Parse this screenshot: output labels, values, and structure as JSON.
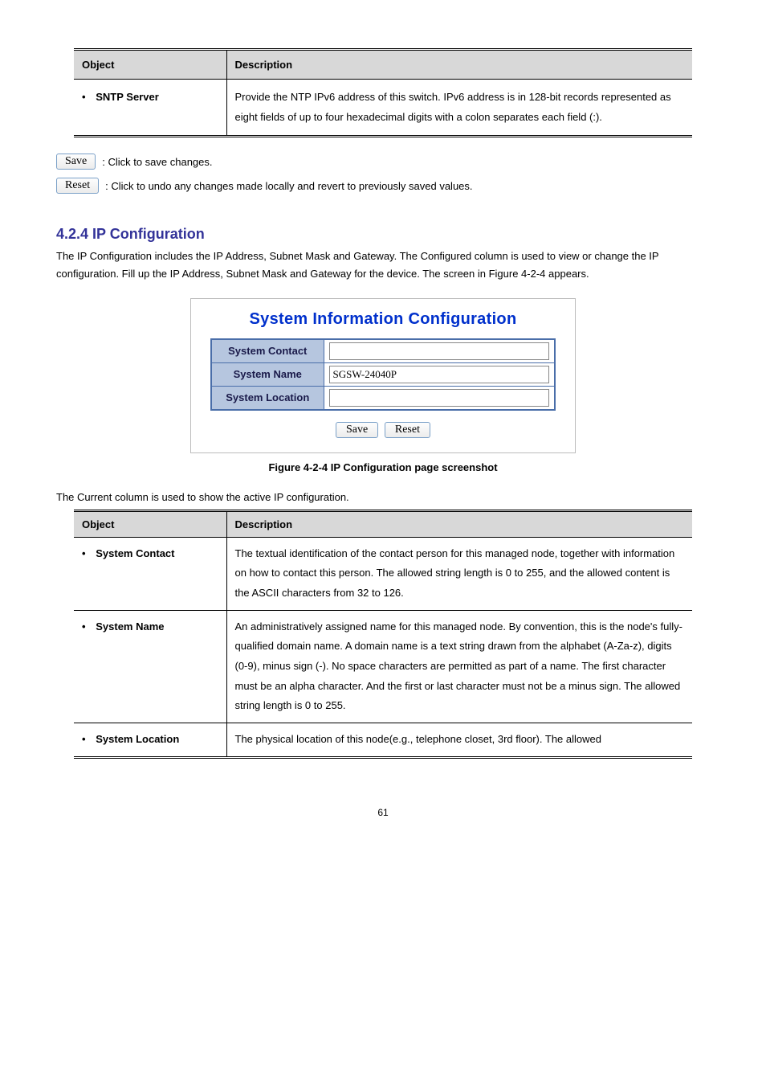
{
  "table1": {
    "headers": {
      "object": "Object",
      "description": "Description"
    },
    "rows": [
      {
        "object": "SNTP Server",
        "description": "Provide the NTP IPv6 address of this switch. IPv6 address is in 128-bit records represented as eight fields of up to four hexadecimal digits with a colon separates each field (:)."
      }
    ]
  },
  "buttons": {
    "save": {
      "label": "Save",
      "desc": ": Click to save changes."
    },
    "reset": {
      "label": "Reset",
      "desc": ": Click to undo any changes made locally and revert to previously saved values."
    }
  },
  "section": {
    "title": "4.2.4 IP Configuration",
    "body": "The IP Configuration includes the IP Address, Subnet Mask and Gateway. The Configured column is used to view or change the IP configuration. Fill up the IP Address, Subnet Mask and Gateway for the device. The screen in Figure 4-2-4 appears."
  },
  "config": {
    "title": "System Information Configuration",
    "rows": {
      "contact": {
        "label": "System Contact",
        "value": ""
      },
      "name": {
        "label": "System Name",
        "value": "SGSW-24040P"
      },
      "location": {
        "label": "System Location",
        "value": ""
      }
    },
    "save": "Save",
    "reset": "Reset"
  },
  "figure_caption": "Figure 4-2-4 IP Configuration page screenshot",
  "page_intro": "The Current column is used to show the active IP configuration.",
  "table2": {
    "headers": {
      "object": "Object",
      "description": "Description"
    },
    "rows": [
      {
        "object": "System Contact",
        "description": "The textual identification of the contact person for this managed node, together with information on how to contact this person. The allowed string length is 0 to 255, and the allowed content is the ASCII characters from 32 to 126."
      },
      {
        "object": "System Name",
        "description": "An administratively assigned name for this managed node. By convention, this is the node's fully-qualified domain name. A domain name is a text string drawn from the alphabet (A-Za-z), digits (0-9), minus sign (-). No space characters are permitted as part of a name. The first character must be an alpha character. And the first or last character must not be a minus sign. The allowed string length is 0 to 255."
      },
      {
        "object": "System Location",
        "description": "The physical location of this node(e.g., telephone closet, 3rd floor). The allowed"
      }
    ]
  },
  "page_number": "61"
}
